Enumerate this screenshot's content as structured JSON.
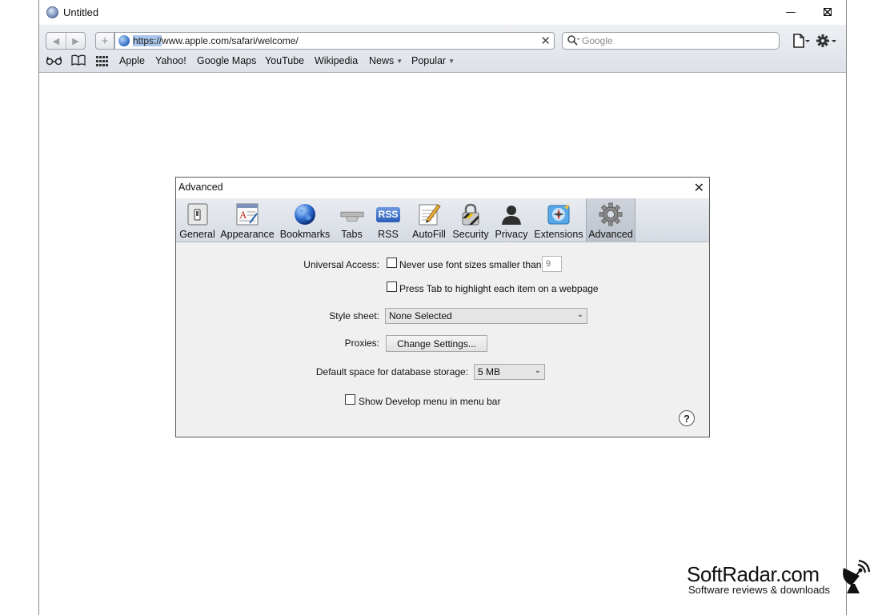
{
  "window": {
    "title": "Untitled",
    "controls": {
      "minimize": "—",
      "maximize": "☐",
      "close": "✕"
    }
  },
  "toolbar": {
    "back_icon": "◀",
    "forward_icon": "▶",
    "add_icon": "+",
    "url_highlighted": "https://",
    "url_rest": "www.apple.com/safari/welcome/",
    "url_clear_icon": "✕",
    "search_placeholder": "Google",
    "search_icon": "🔍",
    "page_menu_icon": "page-menu-icon",
    "settings_menu_icon": "gear-menu-icon"
  },
  "bookmarks": {
    "items": [
      {
        "label": "Apple"
      },
      {
        "label": "Yahoo!"
      },
      {
        "label": "Google Maps"
      },
      {
        "label": "YouTube"
      },
      {
        "label": "Wikipedia"
      },
      {
        "label": "News",
        "caret": "▼"
      },
      {
        "label": "Popular",
        "caret": "▼"
      }
    ]
  },
  "dialog": {
    "title": "Advanced",
    "close_icon": "✕",
    "tabs": [
      {
        "label": "General",
        "icon": "switch-icon"
      },
      {
        "label": "Appearance",
        "icon": "font-icon"
      },
      {
        "label": "Bookmarks",
        "icon": "globe-icon"
      },
      {
        "label": "Tabs",
        "icon": "tabs-icon"
      },
      {
        "label": "RSS",
        "icon": "rss-icon",
        "badge": "RSS"
      },
      {
        "label": "AutoFill",
        "icon": "pencil-icon"
      },
      {
        "label": "Security",
        "icon": "lock-icon"
      },
      {
        "label": "Privacy",
        "icon": "person-icon"
      },
      {
        "label": "Extensions",
        "icon": "puzzle-icon"
      },
      {
        "label": "Advanced",
        "icon": "gear-icon",
        "selected": true
      }
    ],
    "settings": {
      "universal_access_label": "Universal Access:",
      "min_font_label": "Never use font sizes smaller than",
      "min_font_value": "9",
      "min_font_checked": false,
      "tab_highlight_label": "Press Tab to highlight each item on a webpage",
      "tab_highlight_checked": false,
      "style_sheet_label": "Style sheet:",
      "style_sheet_value": "None Selected",
      "proxies_label": "Proxies:",
      "proxies_button": "Change Settings...",
      "db_storage_label": "Default space for database storage:",
      "db_storage_value": "5 MB",
      "develop_menu_label": "Show Develop menu in menu bar",
      "develop_menu_checked": false,
      "help_button": "?"
    }
  },
  "watermark": {
    "title": "SoftRadar.com",
    "subtitle": "Software reviews & downloads"
  }
}
